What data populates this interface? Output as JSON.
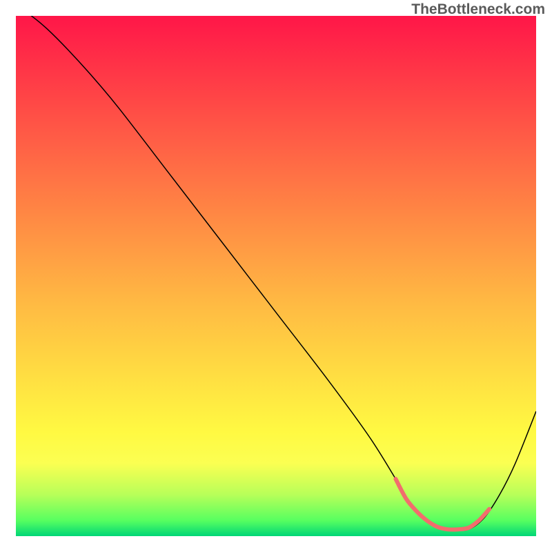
{
  "watermark": {
    "text": "TheBottleneck.com"
  },
  "chart_data": {
    "type": "line",
    "title": "",
    "xlabel": "",
    "ylabel": "",
    "xlim": [
      0,
      100
    ],
    "ylim": [
      0,
      100
    ],
    "grid": false,
    "legend": false,
    "background": {
      "type": "vertical_gradient",
      "stops": [
        {
          "offset": 0.0,
          "color": "#ff1648"
        },
        {
          "offset": 0.2,
          "color": "#ff5246"
        },
        {
          "offset": 0.4,
          "color": "#ff8d44"
        },
        {
          "offset": 0.55,
          "color": "#ffb943"
        },
        {
          "offset": 0.7,
          "color": "#ffe042"
        },
        {
          "offset": 0.8,
          "color": "#fff942"
        },
        {
          "offset": 0.86,
          "color": "#fbff52"
        },
        {
          "offset": 0.92,
          "color": "#b8ff59"
        },
        {
          "offset": 0.97,
          "color": "#57ff60"
        },
        {
          "offset": 1.0,
          "color": "#00d676"
        }
      ]
    },
    "series": [
      {
        "name": "curve",
        "color": "#000000",
        "width": 1.5,
        "x": [
          0,
          3,
          6,
          10,
          15,
          20,
          30,
          40,
          50,
          60,
          68,
          73,
          76,
          80,
          84,
          87,
          90,
          93,
          96,
          100
        ],
        "y": [
          102,
          100,
          97.5,
          93.5,
          88,
          82,
          69,
          56,
          43,
          30,
          19,
          11,
          6,
          2.5,
          1.3,
          1.3,
          3.5,
          8,
          14,
          24
        ]
      },
      {
        "name": "highlight",
        "color": "#f26d6d",
        "width": 6,
        "linecap": "round",
        "x": [
          73,
          75,
          77,
          79,
          81,
          83,
          85,
          87,
          89,
          91
        ],
        "y": [
          11,
          7.2,
          4.8,
          3.0,
          1.8,
          1.3,
          1.3,
          1.6,
          3.0,
          5.2
        ]
      }
    ]
  }
}
